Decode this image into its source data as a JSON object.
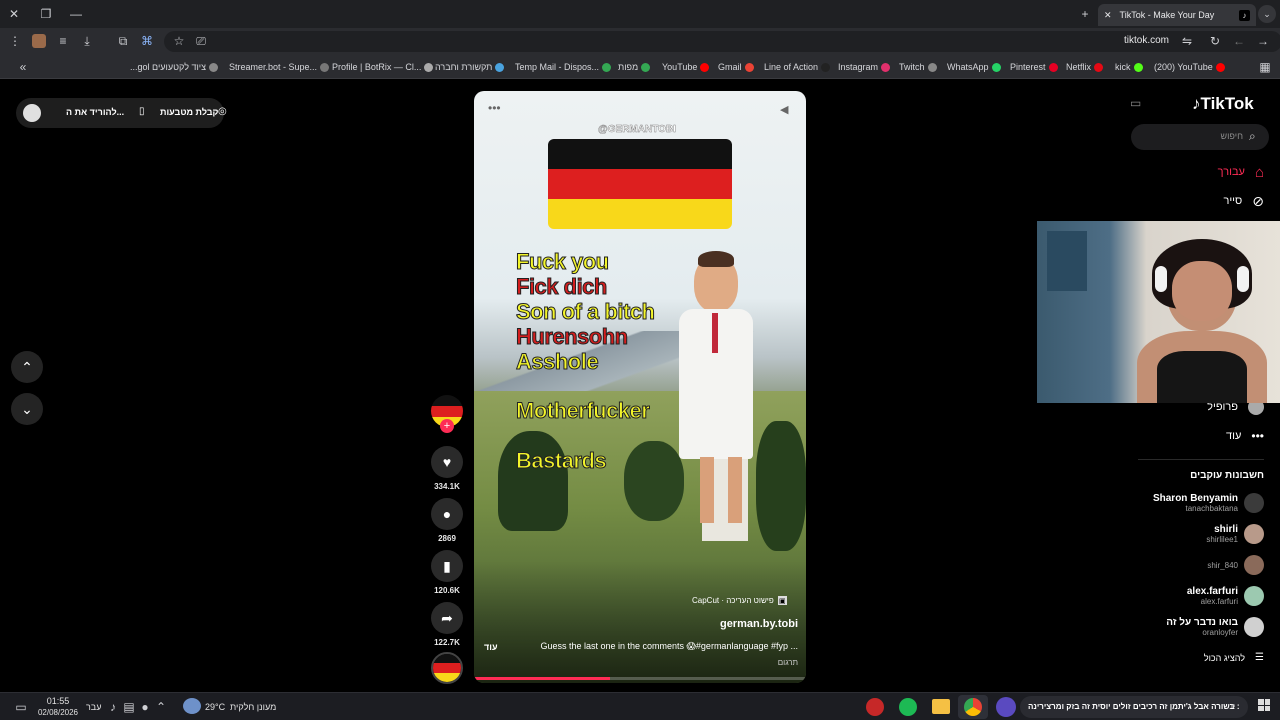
{
  "browser": {
    "tab_title": "TikTok - Make Your Day",
    "url": "tiktok.com",
    "bookmarks": [
      {
        "label": "...gol ציוד לקטעועים",
        "color": "#888888"
      },
      {
        "label": "Streamer.bot - Supe...",
        "color": "#777777"
      },
      {
        "label": "Profile | BotRix — Cl...",
        "color": "#aaaaaa"
      },
      {
        "label": "תקשורת וחברה",
        "color": "#ffffff"
      },
      {
        "label": "Temp Mail - Dispos...",
        "color": "#4aa3df"
      },
      {
        "label": "מפות",
        "color": "#34a853"
      },
      {
        "label": "YouTube",
        "color": "#34a853"
      },
      {
        "label": "Gmail",
        "color": "#ff0000"
      },
      {
        "label": "Line of Action",
        "color": "#ea4335"
      },
      {
        "label": "Instagram",
        "color": "#222222"
      },
      {
        "label": "Twitch",
        "color": "#e1306c"
      },
      {
        "label": "WhatsApp",
        "color": "#888888"
      },
      {
        "label": "Pinterest",
        "color": "#25d366"
      },
      {
        "label": "Netflix",
        "color": "#e60023"
      },
      {
        "label": "kick",
        "color": "#e50914"
      },
      {
        "label": "(200) YouTube",
        "color": "#53fc18"
      }
    ]
  },
  "topleft": {
    "gift_label": "קבלת מטבעות",
    "download_label": "להוריד את ה..."
  },
  "video": {
    "watermark": "@GERMANTOBI",
    "lines": [
      {
        "text": "Fuck you",
        "color": "#f3f52a"
      },
      {
        "text": "Fick dich",
        "color": "#d41e1e"
      },
      {
        "text": "Son of a bitch",
        "color": "#f3f52a"
      },
      {
        "text": "Hurensohn",
        "color": "#d41e1e"
      },
      {
        "text": "Asshole",
        "color": "#f3f52a"
      },
      {
        "text": "Motherfucker",
        "color": "#f3f52a"
      },
      {
        "text": "Bastards",
        "color": "#f3f52a"
      }
    ],
    "capcut_label": "CapCut · פישוט העריכה",
    "author": "german.by.tobi",
    "caption": "Guess the last one in the comments 😱#germanlanguage #fyp ...",
    "more_label": "עוד",
    "translate_label": "תרגום",
    "progress": 0.41
  },
  "actions": {
    "likes": "334.1K",
    "comments": "2869",
    "saves": "120.6K",
    "shares": "122.7K"
  },
  "sidebar": {
    "logo": "TikTok",
    "search_placeholder": "חיפוש",
    "nav": [
      {
        "label": "עבורך",
        "icon": "home-icon",
        "active": true
      },
      {
        "label": "סייר",
        "icon": "compass-icon",
        "active": false
      }
    ],
    "profile_label": "פרופיל",
    "more_label": "עוד",
    "following_title": "חשבונות עוקבים",
    "accounts": [
      {
        "name": "Sharon Benyamin",
        "user": "tanachbaktana"
      },
      {
        "name": "shirli",
        "user": "shirlilee1"
      },
      {
        "name": "",
        "user": "shir_840"
      },
      {
        "name": "alex.farfuri",
        "user": "alex.farfuri"
      },
      {
        "name": "בואו נדבר על זה",
        "user": "oranloyfer"
      }
    ],
    "show_all": "להציג הכול"
  },
  "taskbar": {
    "time": "01:55",
    "date": "02/08/2026",
    "lang": "עבר",
    "weather": "29°C",
    "weather_desc": "מעונן חלקית",
    "ticker": "בשורה אבל ג'יתמן זה רכיבים זולים יוסית זה בזק ומרצירינה :"
  },
  "colors": {
    "accent": "#fe2c55"
  }
}
